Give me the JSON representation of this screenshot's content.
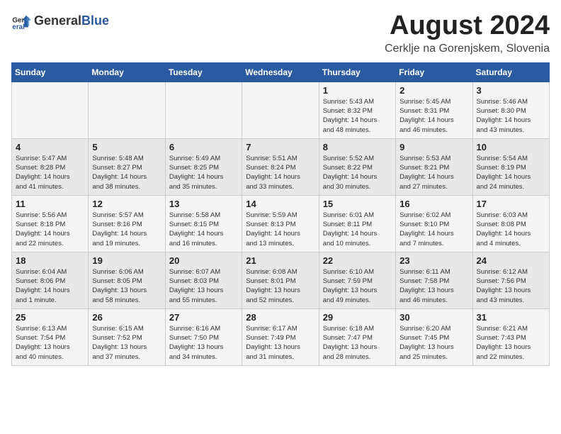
{
  "header": {
    "logo_general": "General",
    "logo_blue": "Blue",
    "month_title": "August 2024",
    "location": "Cerklje na Gorenjskem, Slovenia"
  },
  "calendar": {
    "days_of_week": [
      "Sunday",
      "Monday",
      "Tuesday",
      "Wednesday",
      "Thursday",
      "Friday",
      "Saturday"
    ],
    "weeks": [
      [
        {
          "day": "",
          "info": ""
        },
        {
          "day": "",
          "info": ""
        },
        {
          "day": "",
          "info": ""
        },
        {
          "day": "",
          "info": ""
        },
        {
          "day": "1",
          "info": "Sunrise: 5:43 AM\nSunset: 8:32 PM\nDaylight: 14 hours\nand 48 minutes."
        },
        {
          "day": "2",
          "info": "Sunrise: 5:45 AM\nSunset: 8:31 PM\nDaylight: 14 hours\nand 46 minutes."
        },
        {
          "day": "3",
          "info": "Sunrise: 5:46 AM\nSunset: 8:30 PM\nDaylight: 14 hours\nand 43 minutes."
        }
      ],
      [
        {
          "day": "4",
          "info": "Sunrise: 5:47 AM\nSunset: 8:28 PM\nDaylight: 14 hours\nand 41 minutes."
        },
        {
          "day": "5",
          "info": "Sunrise: 5:48 AM\nSunset: 8:27 PM\nDaylight: 14 hours\nand 38 minutes."
        },
        {
          "day": "6",
          "info": "Sunrise: 5:49 AM\nSunset: 8:25 PM\nDaylight: 14 hours\nand 35 minutes."
        },
        {
          "day": "7",
          "info": "Sunrise: 5:51 AM\nSunset: 8:24 PM\nDaylight: 14 hours\nand 33 minutes."
        },
        {
          "day": "8",
          "info": "Sunrise: 5:52 AM\nSunset: 8:22 PM\nDaylight: 14 hours\nand 30 minutes."
        },
        {
          "day": "9",
          "info": "Sunrise: 5:53 AM\nSunset: 8:21 PM\nDaylight: 14 hours\nand 27 minutes."
        },
        {
          "day": "10",
          "info": "Sunrise: 5:54 AM\nSunset: 8:19 PM\nDaylight: 14 hours\nand 24 minutes."
        }
      ],
      [
        {
          "day": "11",
          "info": "Sunrise: 5:56 AM\nSunset: 8:18 PM\nDaylight: 14 hours\nand 22 minutes."
        },
        {
          "day": "12",
          "info": "Sunrise: 5:57 AM\nSunset: 8:16 PM\nDaylight: 14 hours\nand 19 minutes."
        },
        {
          "day": "13",
          "info": "Sunrise: 5:58 AM\nSunset: 8:15 PM\nDaylight: 14 hours\nand 16 minutes."
        },
        {
          "day": "14",
          "info": "Sunrise: 5:59 AM\nSunset: 8:13 PM\nDaylight: 14 hours\nand 13 minutes."
        },
        {
          "day": "15",
          "info": "Sunrise: 6:01 AM\nSunset: 8:11 PM\nDaylight: 14 hours\nand 10 minutes."
        },
        {
          "day": "16",
          "info": "Sunrise: 6:02 AM\nSunset: 8:10 PM\nDaylight: 14 hours\nand 7 minutes."
        },
        {
          "day": "17",
          "info": "Sunrise: 6:03 AM\nSunset: 8:08 PM\nDaylight: 14 hours\nand 4 minutes."
        }
      ],
      [
        {
          "day": "18",
          "info": "Sunrise: 6:04 AM\nSunset: 8:06 PM\nDaylight: 14 hours\nand 1 minute."
        },
        {
          "day": "19",
          "info": "Sunrise: 6:06 AM\nSunset: 8:05 PM\nDaylight: 13 hours\nand 58 minutes."
        },
        {
          "day": "20",
          "info": "Sunrise: 6:07 AM\nSunset: 8:03 PM\nDaylight: 13 hours\nand 55 minutes."
        },
        {
          "day": "21",
          "info": "Sunrise: 6:08 AM\nSunset: 8:01 PM\nDaylight: 13 hours\nand 52 minutes."
        },
        {
          "day": "22",
          "info": "Sunrise: 6:10 AM\nSunset: 7:59 PM\nDaylight: 13 hours\nand 49 minutes."
        },
        {
          "day": "23",
          "info": "Sunrise: 6:11 AM\nSunset: 7:58 PM\nDaylight: 13 hours\nand 46 minutes."
        },
        {
          "day": "24",
          "info": "Sunrise: 6:12 AM\nSunset: 7:56 PM\nDaylight: 13 hours\nand 43 minutes."
        }
      ],
      [
        {
          "day": "25",
          "info": "Sunrise: 6:13 AM\nSunset: 7:54 PM\nDaylight: 13 hours\nand 40 minutes."
        },
        {
          "day": "26",
          "info": "Sunrise: 6:15 AM\nSunset: 7:52 PM\nDaylight: 13 hours\nand 37 minutes."
        },
        {
          "day": "27",
          "info": "Sunrise: 6:16 AM\nSunset: 7:50 PM\nDaylight: 13 hours\nand 34 minutes."
        },
        {
          "day": "28",
          "info": "Sunrise: 6:17 AM\nSunset: 7:49 PM\nDaylight: 13 hours\nand 31 minutes."
        },
        {
          "day": "29",
          "info": "Sunrise: 6:18 AM\nSunset: 7:47 PM\nDaylight: 13 hours\nand 28 minutes."
        },
        {
          "day": "30",
          "info": "Sunrise: 6:20 AM\nSunset: 7:45 PM\nDaylight: 13 hours\nand 25 minutes."
        },
        {
          "day": "31",
          "info": "Sunrise: 6:21 AM\nSunset: 7:43 PM\nDaylight: 13 hours\nand 22 minutes."
        }
      ]
    ]
  }
}
